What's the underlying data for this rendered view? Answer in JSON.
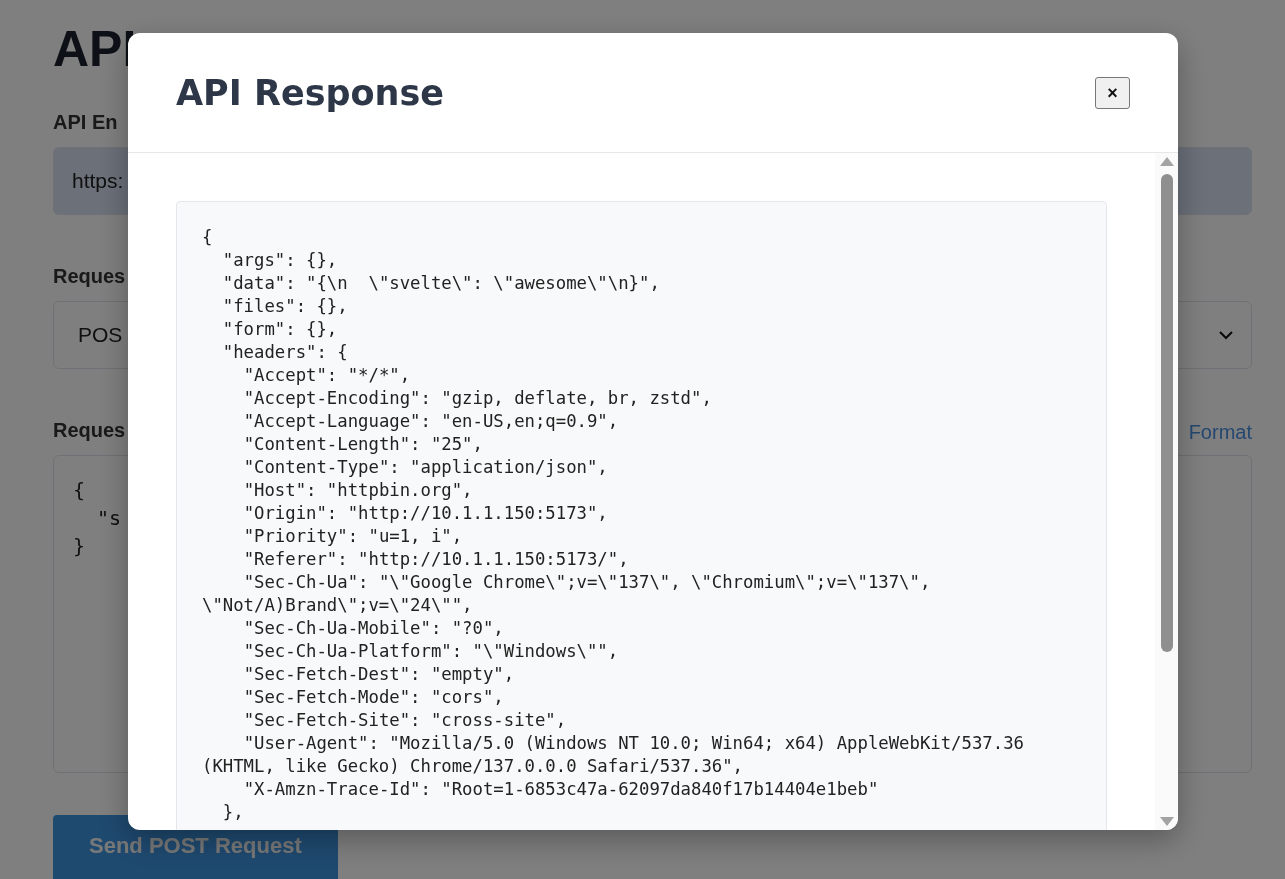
{
  "page": {
    "title": "API",
    "endpoint_label": "API En",
    "endpoint_value": "https:",
    "method_label": "Reques",
    "method_value": "POS",
    "body_label": "Reques",
    "format_link": "Format",
    "body_lines": [
      "{",
      "  \"s",
      "}"
    ],
    "send_button": "Send POST Request"
  },
  "modal": {
    "title": "API Response",
    "close": "×",
    "response_lines": [
      "{",
      "  \"args\": {},",
      "  \"data\": \"{\\n  \\\"svelte\\\": \\\"awesome\\\"\\n}\",",
      "  \"files\": {},",
      "  \"form\": {},",
      "  \"headers\": {",
      "    \"Accept\": \"*/*\",",
      "    \"Accept-Encoding\": \"gzip, deflate, br, zstd\",",
      "    \"Accept-Language\": \"en-US,en;q=0.9\",",
      "    \"Content-Length\": \"25\",",
      "    \"Content-Type\": \"application/json\",",
      "    \"Host\": \"httpbin.org\",",
      "    \"Origin\": \"http://10.1.1.150:5173\",",
      "    \"Priority\": \"u=1, i\",",
      "    \"Referer\": \"http://10.1.1.150:5173/\",",
      "    \"Sec-Ch-Ua\": \"\\\"Google Chrome\\\";v=\\\"137\\\", \\\"Chromium\\\";v=\\\"137\\\", \\\"Not/A)Brand\\\";v=\\\"24\\\"\",",
      "    \"Sec-Ch-Ua-Mobile\": \"?0\",",
      "    \"Sec-Ch-Ua-Platform\": \"\\\"Windows\\\"\",",
      "    \"Sec-Fetch-Dest\": \"empty\",",
      "    \"Sec-Fetch-Mode\": \"cors\",",
      "    \"Sec-Fetch-Site\": \"cross-site\",",
      "    \"User-Agent\": \"Mozilla/5.0 (Windows NT 10.0; Win64; x64) AppleWebKit/537.36 (KHTML, like Gecko) Chrome/137.0.0.0 Safari/537.36\",",
      "    \"X-Amzn-Trace-Id\": \"Root=1-6853c47a-62097da840f17b14404e1beb\"",
      "  },"
    ]
  }
}
